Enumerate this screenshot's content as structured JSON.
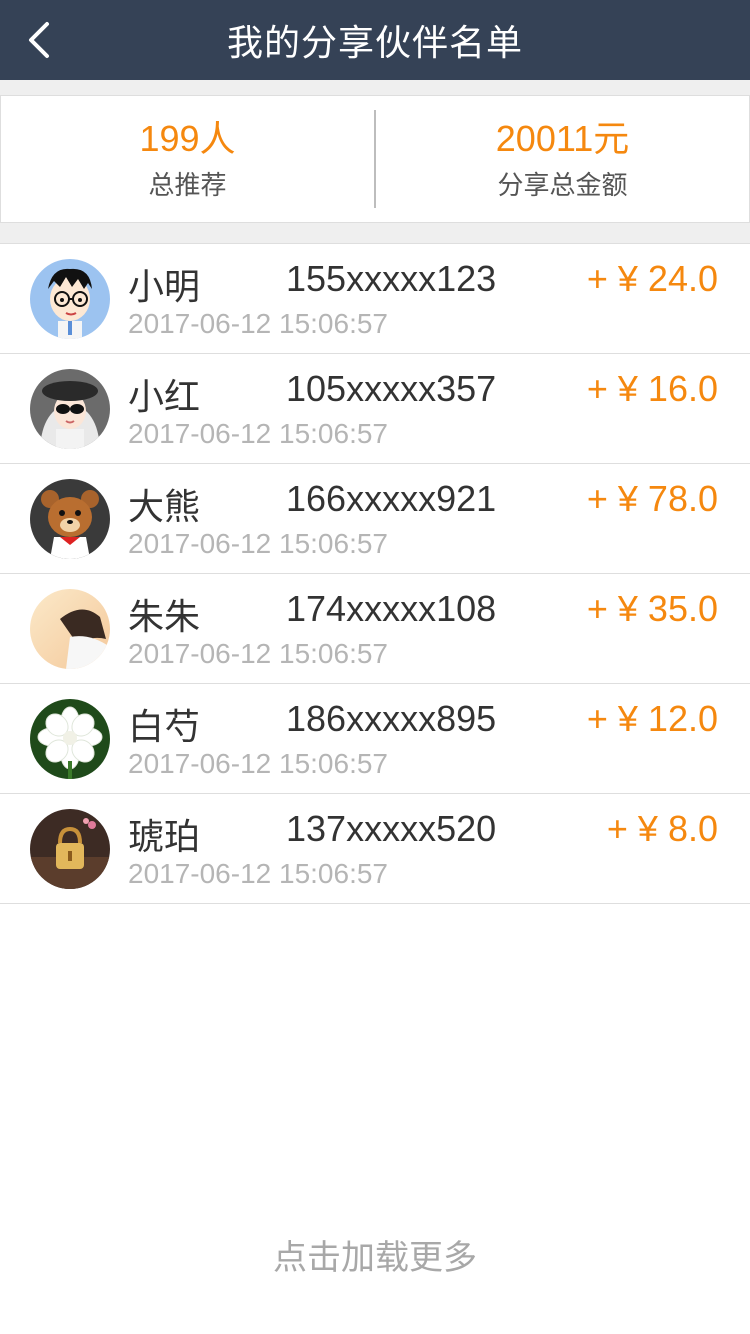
{
  "header": {
    "title": "我的分享伙伴名单"
  },
  "stats": {
    "total_count": "199人",
    "total_count_label": "总推荐",
    "total_amount": "20011元",
    "total_amount_label": "分享总金额"
  },
  "partners": [
    {
      "name": "小明",
      "phone": "155xxxxx123",
      "amount": "+ ¥ 24.0",
      "time": "2017-06-12 15:06:57",
      "avatar": "cartoon-boy-glasses"
    },
    {
      "name": "小红",
      "phone": "105xxxxx357",
      "amount": "+ ¥ 16.0",
      "time": "2017-06-12 15:06:57",
      "avatar": "cartoon-girl-sunglasses"
    },
    {
      "name": "大熊",
      "phone": "166xxxxx921",
      "amount": "+ ¥ 78.0",
      "time": "2017-06-12 15:06:57",
      "avatar": "cartoon-bear"
    },
    {
      "name": "朱朱",
      "phone": "174xxxxx108",
      "amount": "+ ¥ 35.0",
      "time": "2017-06-12 15:06:57",
      "avatar": "photo-girl"
    },
    {
      "name": "白芍",
      "phone": "186xxxxx895",
      "amount": "+ ¥ 12.0",
      "time": "2017-06-12 15:06:57",
      "avatar": "photo-white-flower"
    },
    {
      "name": "琥珀",
      "phone": "137xxxxx520",
      "amount": "+ ¥ 8.0",
      "time": "2017-06-12 15:06:57",
      "avatar": "photo-amber-lock"
    }
  ],
  "footer": {
    "load_more": "点击加载更多"
  },
  "colors": {
    "header_bg": "#354256",
    "accent": "#f5880f"
  }
}
